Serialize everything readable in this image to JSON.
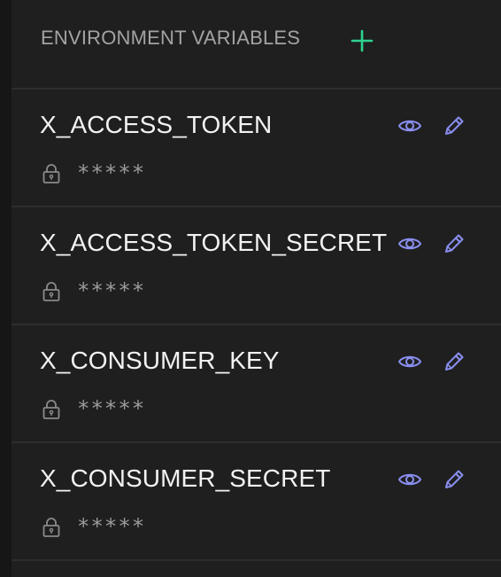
{
  "header": {
    "title": "ENVIRONMENT VARIABLES",
    "add_icon": "plus-icon"
  },
  "colors": {
    "background": "#1f1f1f",
    "accent_green": "#2fd18f",
    "icon_purple": "#8a8ff0",
    "text_primary": "#f2f2f2",
    "text_muted": "#a3a3a3",
    "divider": "#2d2d2d"
  },
  "variables": [
    {
      "name": "X_ACCESS_TOKEN",
      "value": "*****",
      "view_icon": "eye-icon",
      "edit_icon": "pencil-icon",
      "lock_icon": "lock-icon"
    },
    {
      "name": "X_ACCESS_TOKEN_SECRET",
      "value": "*****",
      "view_icon": "eye-icon",
      "edit_icon": "pencil-icon",
      "lock_icon": "lock-icon"
    },
    {
      "name": "X_CONSUMER_KEY",
      "value": "*****",
      "view_icon": "eye-icon",
      "edit_icon": "pencil-icon",
      "lock_icon": "lock-icon"
    },
    {
      "name": "X_CONSUMER_SECRET",
      "value": "*****",
      "view_icon": "eye-icon",
      "edit_icon": "pencil-icon",
      "lock_icon": "lock-icon"
    }
  ]
}
